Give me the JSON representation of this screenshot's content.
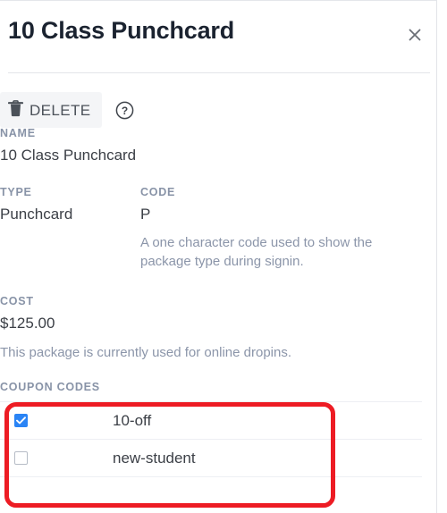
{
  "dialog": {
    "title": "10 Class Punchcard",
    "close_icon": "close-icon"
  },
  "actions": {
    "delete_label": "DELETE",
    "delete_icon": "trash-icon",
    "help_icon": "help-circle-icon"
  },
  "fields": {
    "name": {
      "label": "NAME",
      "value": "10 Class Punchcard"
    },
    "type": {
      "label": "TYPE",
      "value": "Punchcard"
    },
    "code": {
      "label": "CODE",
      "value": "P",
      "help": "A one character code used to show the package type during signin."
    },
    "cost": {
      "label": "COST",
      "value": "$125.00",
      "note": "This package is currently used for online dropins."
    }
  },
  "coupon_codes": {
    "label": "COUPON CODES",
    "rows": [
      {
        "name": "10-off",
        "checked": true
      },
      {
        "name": "new-student",
        "checked": false
      }
    ]
  },
  "annotation": {
    "shape": "rounded-rectangle-highlight",
    "color": "#ED1C24"
  },
  "colors": {
    "accent_blue": "#2A84F5",
    "label_gray": "#8893A7",
    "text_dark": "#3B3F46",
    "title_dark": "#1B2330",
    "annotation_red": "#ED1C24",
    "divider": "#E3E5E9",
    "button_bg": "#F4F5F7"
  }
}
